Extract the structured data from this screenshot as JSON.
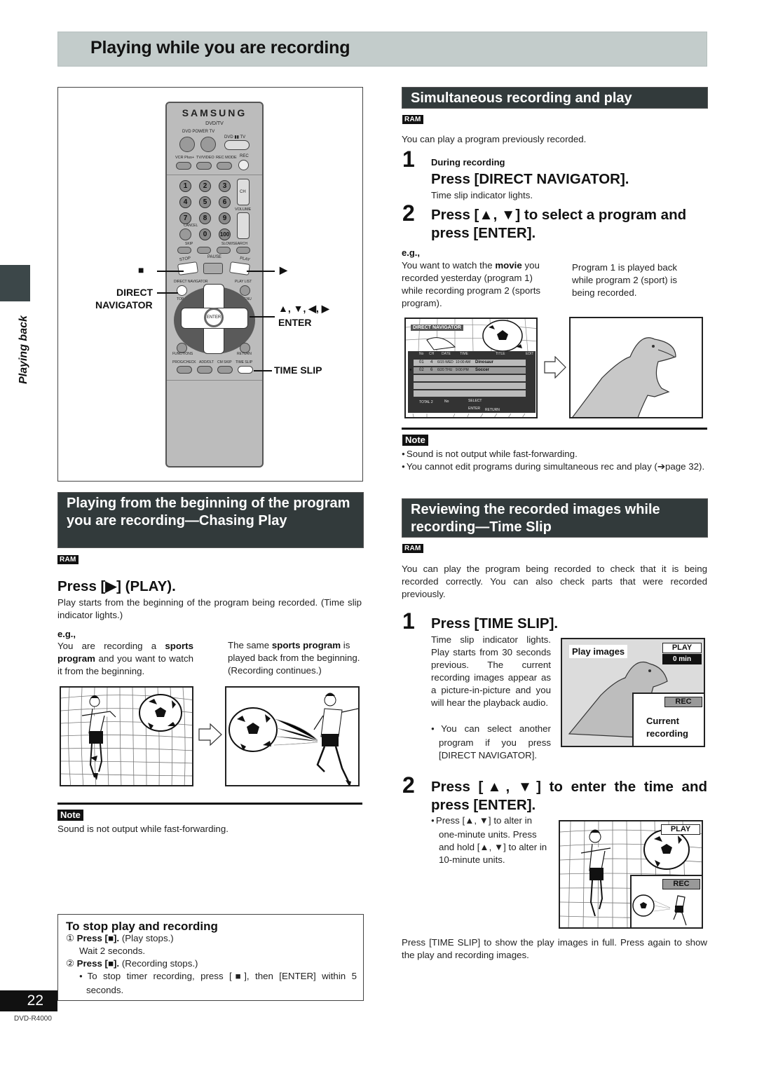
{
  "page": {
    "title": "Playing while you are recording",
    "side_tab_label": "Playing back",
    "page_number": "22",
    "model": "DVD-R4000"
  },
  "remote": {
    "brand": "SAMSUNG",
    "subtitle": "DVD/TV",
    "labels": {
      "power": "DVD POWER TV",
      "dvd_tv": "DVD ▮▮ TV",
      "vcr_plus": "VCR Plus+",
      "tv_video": "TV/VIDEO",
      "rec_mode": "REC MODE",
      "rec": "REC",
      "ch": "CH",
      "volume": "VOLUME",
      "cancel": "CANCEL",
      "skip": "SKIP",
      "slow_search": "SLOW/SEARCH",
      "stop": "STOP",
      "pause": "PAUSE",
      "play": "PLAY",
      "direct_navigator": "DIRECT NAVIGATOR",
      "play_list": "PLAY LIST",
      "top_menu": "TOP MENU",
      "menu": "MENU",
      "enter": "ENTER",
      "functions": "FUNCTIONS",
      "return": "RETURN",
      "prog_check": "PROG/CHECK",
      "add_dlt": "ADD/DLT",
      "cm_skip": "CM SKIP",
      "time_slip": "TIME SLIP"
    },
    "numbers": [
      "1",
      "2",
      "3",
      "4",
      "5",
      "6",
      "7",
      "8",
      "9",
      "0",
      "100"
    ],
    "callouts": {
      "stop": "■",
      "play": "▶",
      "direct_navigator_1": "DIRECT",
      "direct_navigator_2": "NAVIGATOR",
      "arrows": "▲, ▼, ◀, ▶",
      "enter": "ENTER",
      "time_slip": "TIME SLIP"
    }
  },
  "chasing": {
    "heading": "Playing from the beginning of the program you are recording—Chasing Play",
    "badge": "RAM",
    "step_title": "Press [▶] (PLAY).",
    "desc": "Play starts from the beginning of the program being recorded. (Time slip indicator lights.)",
    "eg_label": "e.g.,",
    "eg_left_1": "You are recording a ",
    "eg_left_bold_1": "sports program",
    "eg_left_2": " and you want to watch it from the beginning.",
    "eg_right_1": "The same ",
    "eg_right_bold": "sports program",
    "eg_right_2": " is played back from the beginning. (Recording continues.)",
    "note_label": "Note",
    "note": "Sound is not output while fast-forwarding."
  },
  "stop_box": {
    "heading": "To stop play and recording",
    "step1_bold": "Press [■].",
    "step1_rest": " (Play stops.)",
    "wait": "Wait 2 seconds.",
    "step2_bold": "Press [■].",
    "step2_rest": " (Recording stops.)",
    "bullet": "To stop timer recording, press [■], then [ENTER] within 5 seconds.",
    "markers": [
      "①",
      "②"
    ]
  },
  "simultaneous": {
    "heading": "Simultaneous recording and play",
    "badge": "RAM",
    "intro": "You can play a program previously recorded.",
    "step1_num": "1",
    "step1_pre": "During recording",
    "step1_title": "Press [DIRECT NAVIGATOR].",
    "step1_desc": "Time slip indicator lights.",
    "step2_num": "2",
    "step2_title": "Press [▲, ▼] to select a program and press [ENTER].",
    "eg_label": "e.g.,",
    "eg_left_1": "You want to watch the ",
    "eg_left_bold": "movie",
    "eg_left_2": " you recorded yesterday (program 1) while recording program 2 (sports program).",
    "eg_right": "Program 1 is played back while program 2 (sport) is being recorded.",
    "note_label": "Note",
    "notes": [
      "Sound is not output while fast-forwarding.",
      "You cannot edit programs during simultaneous rec and play (➔page 32)."
    ]
  },
  "direct_navigator_screen": {
    "title": "DIRECT NAVIGATOR",
    "columns": [
      "No",
      "CH",
      "DATE",
      "TIME",
      "TITLE",
      "EDIT"
    ],
    "rows": [
      {
        "no": "01",
        "ch": "4",
        "date": "6/15 WED",
        "time": "10:00 AM",
        "title": "Dinosaur"
      },
      {
        "no": "02",
        "ch": "6",
        "date": "6/20 THU",
        "time": "9:00 PM",
        "title": "Soccer"
      }
    ],
    "total": "TOTAL 2",
    "no_label": "No",
    "select": "SELECT",
    "enter": "ENTER",
    "return": "RETURN"
  },
  "time_slip": {
    "heading": "Reviewing the recorded images while recording—Time Slip",
    "badge": "RAM",
    "intro": "You can play the program being recorded to check that it is being recorded correctly. You can also check parts that were recorded previously.",
    "step1_num": "1",
    "step1_title": "Press [TIME SLIP].",
    "step1_desc": "Time slip indicator lights. Play starts from 30 seconds previous. The current recording images appear as a picture-in-picture and you will hear the playback audio.",
    "step1_bullet": "You can select another program if you press [DIRECT NAVIGATOR].",
    "screen1": {
      "play_images": "Play images",
      "play": "PLAY",
      "time": "0 min",
      "rec": "REC",
      "current_1": "Current",
      "current_2": "recording"
    },
    "step2_num": "2",
    "step2_title": "Press [▲, ▼] to enter the time and press [ENTER].",
    "step2_bullet": "Press [▲, ▼] to alter in one-minute units. Press and hold [▲, ▼] to alter in 10-minute units.",
    "screen2": {
      "play": "PLAY",
      "rec": "REC"
    },
    "footer": "Press [TIME SLIP] to show the play images in full. Press again to show the play and recording images."
  }
}
